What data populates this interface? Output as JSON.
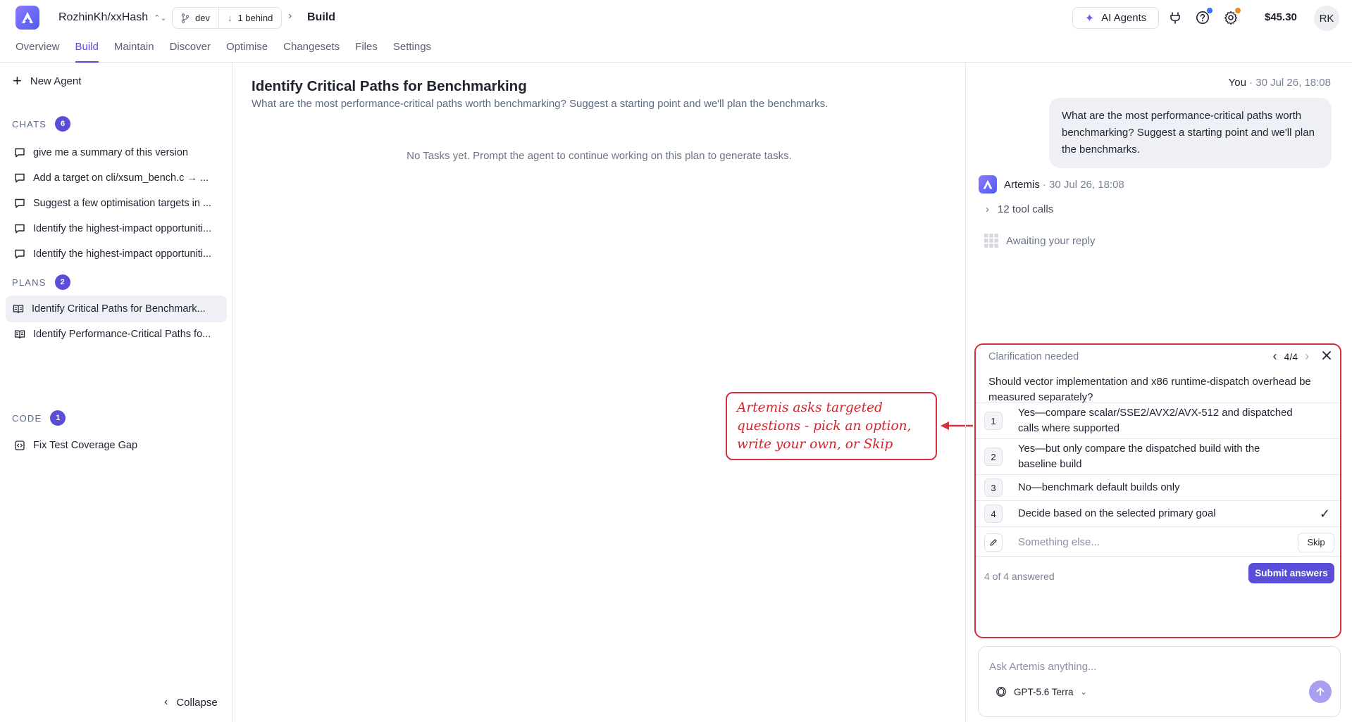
{
  "header": {
    "repo": "RozhinKh/xxHash",
    "branch": "dev",
    "behind": "1 behind",
    "crumb": "Build",
    "ai_agents": "AI Agents",
    "balance": "$45.30",
    "avatar_initials": "RK",
    "help_dot_color": "#3b6cf6",
    "settings_dot_color": "#f08a24"
  },
  "nav_tabs": [
    {
      "label": "Overview"
    },
    {
      "label": "Build"
    },
    {
      "label": "Maintain"
    },
    {
      "label": "Discover"
    },
    {
      "label": "Optimise"
    },
    {
      "label": "Changesets"
    },
    {
      "label": "Files"
    },
    {
      "label": "Settings"
    }
  ],
  "sidebar": {
    "new_agent": "New Agent",
    "chats_title": "CHATS",
    "chats_count": "6",
    "chats": [
      {
        "label": "give me a summary of this version"
      },
      {
        "label": "Add a target on cli/xsum_bench.c → ..."
      },
      {
        "label": "Suggest a few optimisation targets in ..."
      },
      {
        "label": "Identify the highest-impact opportuniti..."
      },
      {
        "label": "Identify the highest-impact opportuniti..."
      }
    ],
    "plans_title": "PLANS",
    "plans_count": "2",
    "plans": [
      {
        "label": "Identify Critical Paths for Benchmark..."
      },
      {
        "label": "Identify Performance-Critical Paths fo..."
      }
    ],
    "code_title": "CODE",
    "code_count": "1",
    "code": [
      {
        "label": "Fix Test Coverage Gap"
      }
    ],
    "collapse": "Collapse"
  },
  "main": {
    "title": "Identify Critical Paths for Benchmarking",
    "subtitle": "What are the most performance-critical paths worth benchmarking? Suggest a starting point and we'll plan the benchmarks.",
    "empty": "No Tasks yet. Prompt the agent to continue working on this plan to generate tasks."
  },
  "callout": {
    "text": "Artemis asks targeted questions - pick an option, write your own, or Skip"
  },
  "chat": {
    "you_name": "You",
    "you_time": "· 30 Jul 26, 18:08",
    "user_message": "What are the most performance-critical paths worth benchmarking? Suggest a starting point and we'll plan the benchmarks.",
    "agent_name": "Artemis",
    "agent_time": "· 30 Jul 26, 18:08",
    "tool_calls": "12 tool calls",
    "awaiting": "Awaiting your reply"
  },
  "clarification": {
    "title": "Clarification needed",
    "pager": "4/4",
    "question": "Should vector implementation and x86 runtime-dispatch overhead be measured separately?",
    "options": [
      {
        "num": "1",
        "text": "Yes—compare scalar/SSE2/AVX2/AVX-512 and dispatched calls where supported"
      },
      {
        "num": "2",
        "text": "Yes—but only compare the dispatched build with the baseline build"
      },
      {
        "num": "3",
        "text": "No—benchmark default builds only"
      },
      {
        "num": "4",
        "text": "Decide based on the selected primary goal"
      }
    ],
    "selected_check": "✓",
    "custom_placeholder": "Something else...",
    "skip": "Skip",
    "answered": "4 of 4 answered",
    "submit": "Submit answers"
  },
  "composer": {
    "placeholder": "Ask Artemis anything...",
    "model": "GPT-5.6 Terra"
  },
  "colors": {
    "accent": "#5a4ed8",
    "annotation": "#d6303a"
  }
}
